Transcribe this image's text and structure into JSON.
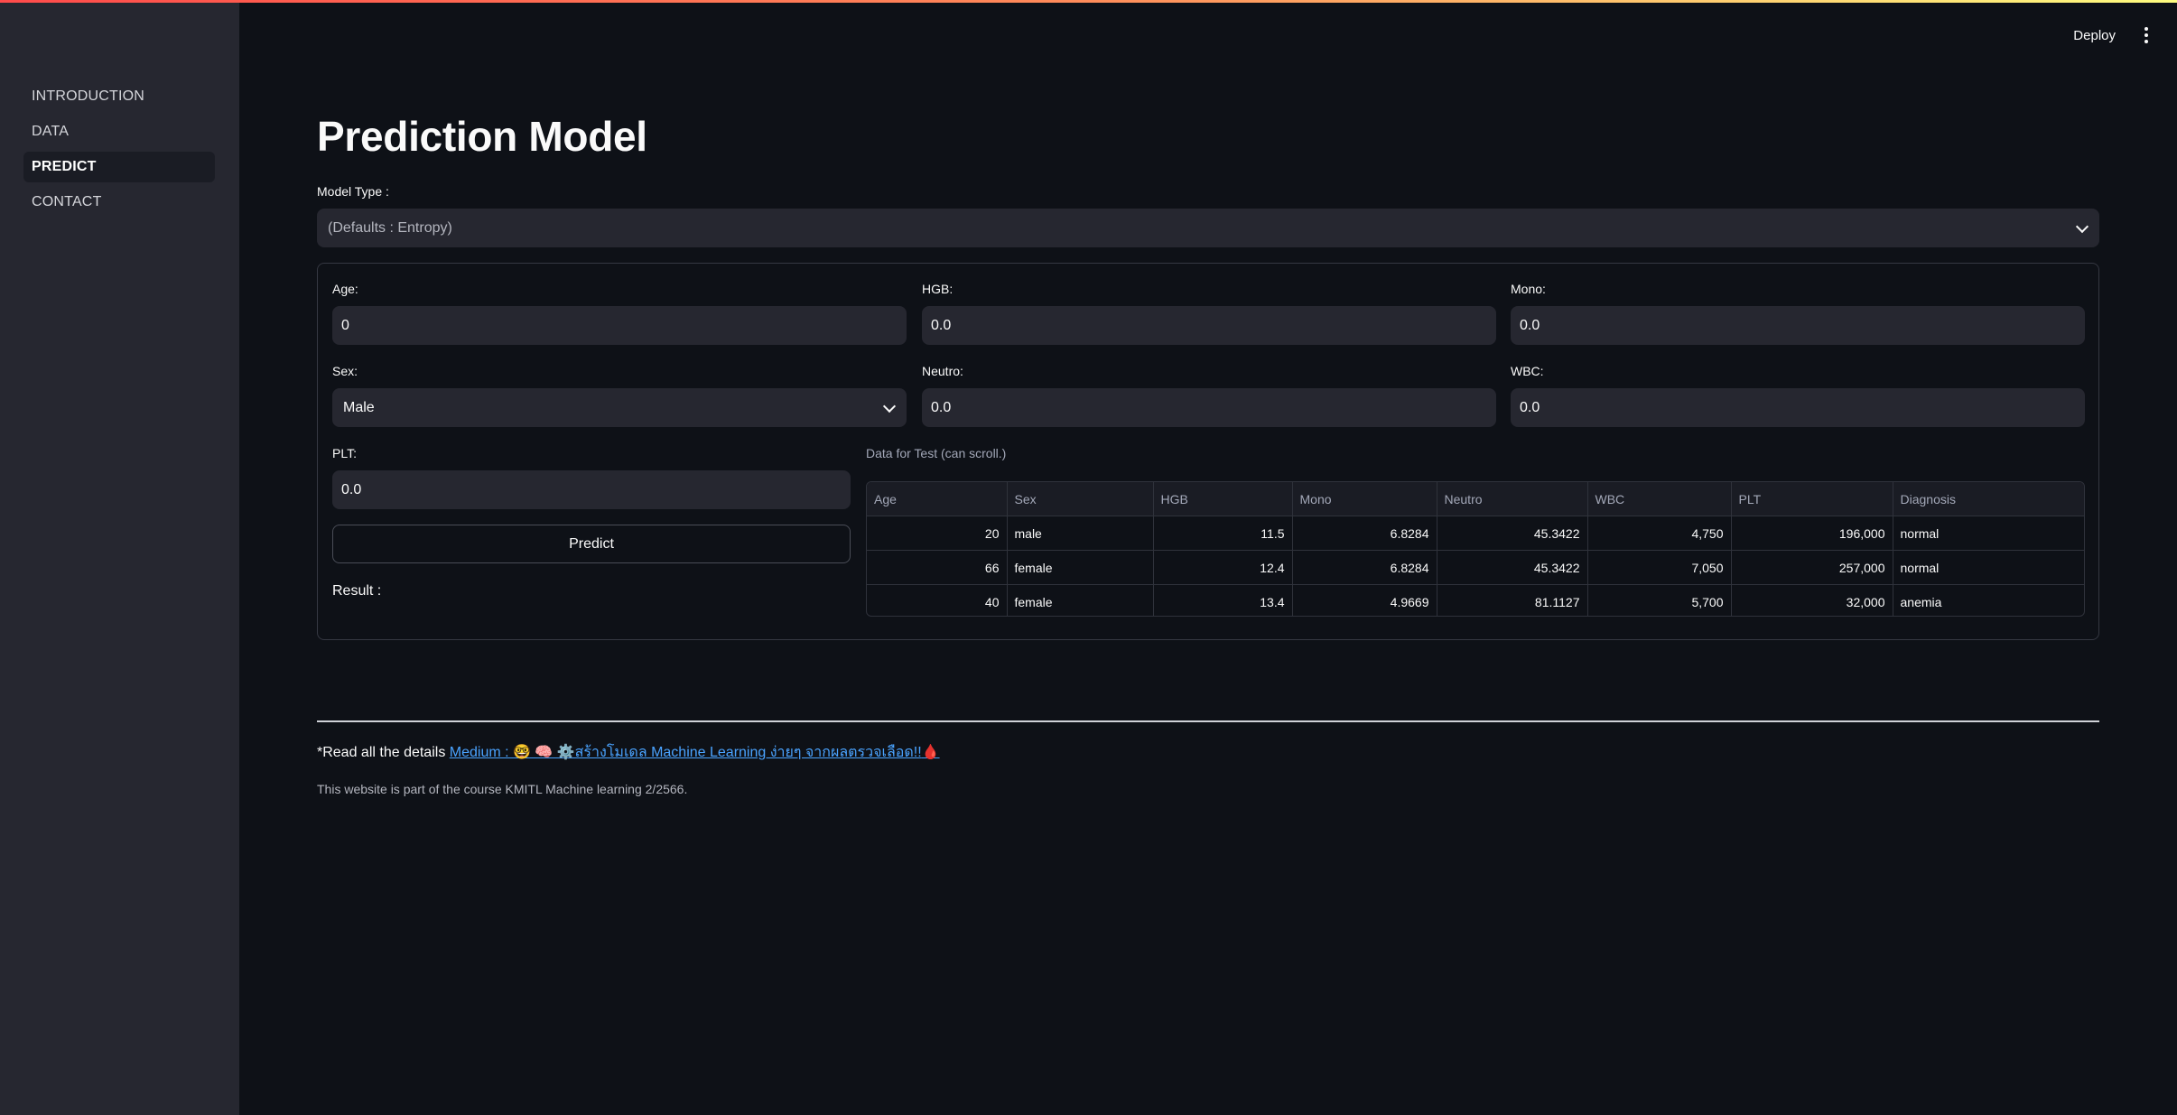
{
  "nav": {
    "items": [
      {
        "label": "INTRODUCTION"
      },
      {
        "label": "DATA"
      },
      {
        "label": "PREDICT"
      },
      {
        "label": "CONTACT"
      }
    ],
    "active": "PREDICT"
  },
  "header": {
    "deploy_label": "Deploy",
    "menu_icon": "kebab-menu-icon"
  },
  "page": {
    "title": "Prediction Model",
    "model_type_label": "Model Type :",
    "model_type_value": "(Defaults : Entropy)"
  },
  "form": {
    "age": {
      "label": "Age:",
      "value": "0"
    },
    "hgb": {
      "label": "HGB:",
      "value": "0.0"
    },
    "mono": {
      "label": "Mono:",
      "value": "0.0"
    },
    "sex": {
      "label": "Sex:",
      "value": "Male"
    },
    "neutro": {
      "label": "Neutro:",
      "value": "0.0"
    },
    "wbc": {
      "label": "WBC:",
      "value": "0.0"
    },
    "plt": {
      "label": "PLT:",
      "value": "0.0"
    },
    "predict_label": "Predict",
    "result_label": "Result :"
  },
  "table": {
    "caption": "Data for Test (can scroll.)",
    "columns": [
      "Age",
      "Sex",
      "HGB",
      "Mono",
      "Neutro",
      "WBC",
      "PLT",
      "Diagnosis"
    ],
    "rows": [
      [
        "20",
        "male",
        "11.5",
        "6.8284",
        "45.3422",
        "4,750",
        "196,000",
        "normal"
      ],
      [
        "66",
        "female",
        "12.4",
        "6.8284",
        "45.3422",
        "7,050",
        "257,000",
        "normal"
      ],
      [
        "40",
        "female",
        "13.4",
        "4.9669",
        "81.1127",
        "5,700",
        "32,000",
        "anemia"
      ]
    ]
  },
  "footer": {
    "read_prefix": "*Read all the details",
    "link_text": "Medium : 🤓 🧠 ⚙️สร้างโมเดล Machine Learning ง่ายๆ จากผลตรวจเลือด!!",
    "link_emoji": "🩸",
    "note": "This website is part of the course KMITL Machine learning 2/2566."
  },
  "colors": {
    "background": "#0e1117",
    "sidebar": "#262730",
    "input": "#262730",
    "link": "#4aa3ff",
    "accent_gradient_start": "#ff4b4b",
    "accent_gradient_end": "#fffd80"
  }
}
